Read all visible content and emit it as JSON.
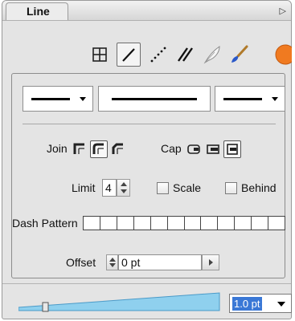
{
  "panel": {
    "tab_label": "Line"
  },
  "toolbar": {
    "tools": [
      {
        "icon": "grid-icon"
      },
      {
        "icon": "pencil-line-icon",
        "selected": true
      },
      {
        "icon": "dotted-line-icon"
      },
      {
        "icon": "double-line-icon"
      },
      {
        "icon": "feather-icon"
      },
      {
        "icon": "paintbrush-icon"
      },
      {
        "icon": "orange-blob-icon"
      }
    ]
  },
  "style_dropdowns": [
    {
      "name": "start-arrowhead"
    },
    {
      "name": "line-style"
    },
    {
      "name": "end-arrowhead"
    }
  ],
  "join": {
    "label": "Join",
    "options": [
      "miter",
      "round",
      "bevel"
    ],
    "selected": "round"
  },
  "cap": {
    "label": "Cap",
    "options": [
      "butt",
      "round",
      "square"
    ],
    "selected": "square"
  },
  "limit": {
    "label": "Limit",
    "value": "4"
  },
  "scale": {
    "label": "Scale",
    "checked": false
  },
  "behind": {
    "label": "Behind",
    "checked": false
  },
  "dash_pattern": {
    "label": "Dash Pattern",
    "cells": 12
  },
  "offset": {
    "label": "Offset",
    "value": "0 pt"
  },
  "width": {
    "value": "1.0 pt"
  },
  "colors": {
    "slider_fill": "#8fd0ee",
    "selection": "#3a78d6",
    "accent_orange": "#f07a20"
  }
}
